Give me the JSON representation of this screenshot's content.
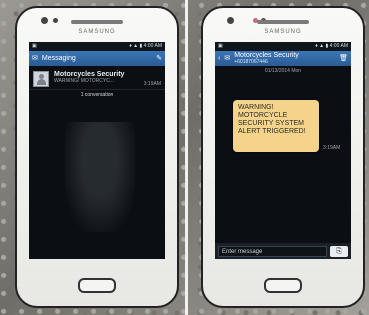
{
  "left": {
    "brand": "SAMSUNG",
    "status": {
      "time": "4:00 AM",
      "icons": "♦ ▲ ▮"
    },
    "appbar": {
      "title": "Messaging"
    },
    "thread": {
      "contact": "Motorcycles Security",
      "snippet": "WARNING! MOTORCYC...",
      "time": "3:19AM",
      "conversations": "1 conversation"
    }
  },
  "right": {
    "brand": "SAMSUNG",
    "status": {
      "time": "4:00 AM",
      "icons": "♦ ▲ ▮"
    },
    "appbar": {
      "title": "Motorcycles Security",
      "number": "+60187067446"
    },
    "date": "01/13/2014 Mon",
    "bubble_text": "WARNING! MOTORCYCLE SECURITY SYSTEM ALERT TRIGGERED!",
    "message_time": "3:19AM",
    "input_placeholder": "Enter message"
  },
  "colors": {
    "appbar": "#2a5b93",
    "bubble": "#f3d48a",
    "screen": "#0b0f14"
  }
}
